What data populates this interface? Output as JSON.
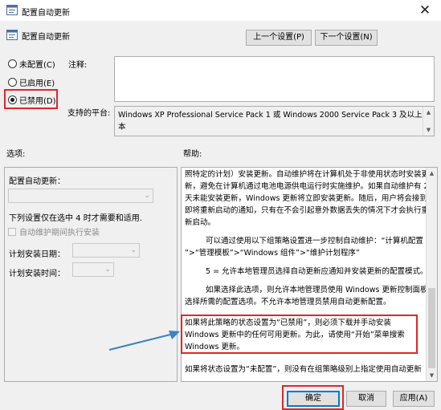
{
  "window": {
    "title": "配置自动更新",
    "close_glyph": "✕"
  },
  "header": {
    "policy_name": "配置自动更新"
  },
  "nav": {
    "prev_label": "上一个设置(P)",
    "next_label": "下一个设置(N)"
  },
  "state": {
    "options": [
      {
        "label": "未配置(C)",
        "selected": false
      },
      {
        "label": "已启用(E)",
        "selected": false
      },
      {
        "label": "已禁用(D)",
        "selected": true
      }
    ]
  },
  "comment": {
    "label": "注释:",
    "value": ""
  },
  "platform": {
    "label": "支持的平台:",
    "value_line1": "Windows XP Professional Service Pack 1 或 Windows 2000 Service Pack 3 及以上版",
    "value_line2": "本"
  },
  "options_section": {
    "label": "选项:",
    "configure_label": "配置自动更新：",
    "note": "下列设置仅在选中 4 时才需要和适用.",
    "maintenance_label": "自动维护期间执行安装",
    "day_label": "计划安装日期：",
    "time_label": "计划安装时间："
  },
  "help_section": {
    "label": "帮助:",
    "lines": [
      "照特定的计划）安装更新。自动维护将在计算机处于非使用状态时安装更",
      "新，避免在计算机通过电池电源供电运行时实施维护。如果自动维护有 2",
      "天未能安装更新，Windows 更新将立即安装更新。随后，用户将会接到",
      "即将重新启动的通知，只有在不会引起意外数据丢失的情况下才会执行重",
      "新启动。",
      "可以通过使用以下组策略设置进一步控制自动维护：“计算机配置",
      "”>“管理模板”>“Windows 组件”>“维护计划程序”",
      "5 = 允许本地管理员选择自动更新应通知并安装更新的配置模式。",
      "如果选择此选项，则允许本地管理员使用 Windows 更新控制面板",
      "选择所需的配置选项。不允许本地管理员禁用自动更新配置。",
      "如果将此策略的状态设置为“已禁用”，则必须下载并手动安装",
      "Windows 更新中的任何可用更新。为此，请使用“开始”菜单搜索",
      "Windows 更新。",
      "如果将状态设置为“未配置”，则没有在组策略级别上指定使用自动更新"
    ]
  },
  "footer": {
    "ok_label": "确定",
    "cancel_label": "取消",
    "apply_label": "应用(A)"
  },
  "colors": {
    "highlight": "#e0262a",
    "arrow": "#3b82c6",
    "accent": "#0078d7"
  }
}
